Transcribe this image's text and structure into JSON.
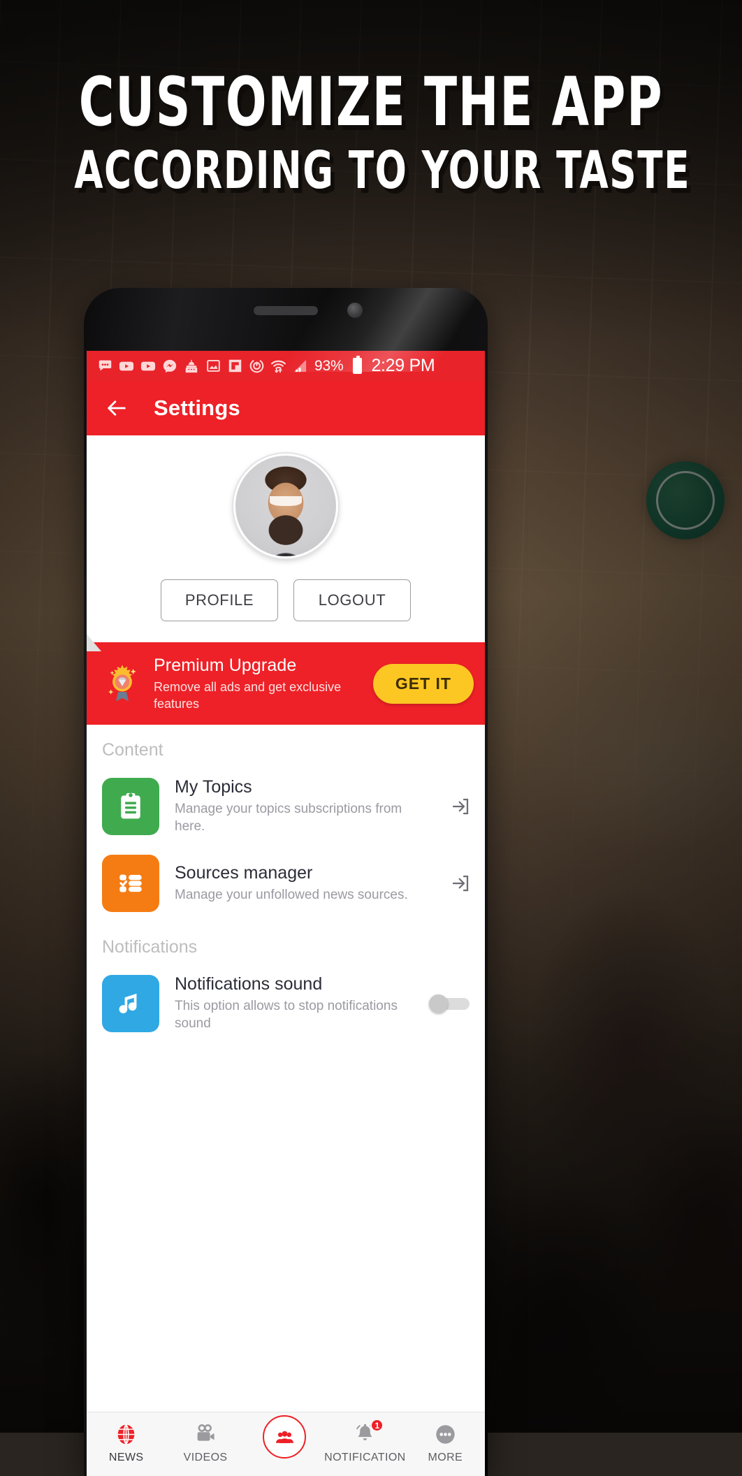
{
  "promo": {
    "headline_line1": "CUSTOMIZE THE APP",
    "headline_line2": "ACCORDING TO YOUR TASTE"
  },
  "status_bar": {
    "icons": [
      "messages-dots-icon",
      "youtube-icon",
      "youtube-icon",
      "messenger-icon",
      "temple-icon",
      "photo-icon",
      "flipboard-icon",
      "power-timer-icon",
      "wifi-transfer-icon",
      "cellular-signal-icon"
    ],
    "battery_percent": "93%",
    "battery_icon": "battery-full-icon",
    "time": "2:29 PM"
  },
  "app_bar": {
    "back_icon": "back-arrow-icon",
    "title": "Settings"
  },
  "profile": {
    "avatar_icon": "user-avatar",
    "buttons": [
      {
        "label": "PROFILE",
        "name": "profile-button"
      },
      {
        "label": "LOGOUT",
        "name": "logout-button"
      }
    ]
  },
  "premium": {
    "badge_icon": "premium-diamond-badge-icon",
    "title": "Premium Upgrade",
    "subtitle": "Remove all ads and get exclusive features",
    "cta_label": "GET IT",
    "cta_color": "#fdc723",
    "background_color": "#ed2127"
  },
  "sections": [
    {
      "header": "Content",
      "rows": [
        {
          "title": "My Topics",
          "subtitle": "Manage your topics subscriptions from here.",
          "icon": "clipboard-icon",
          "icon_color": "#3fab4e",
          "trailing": "open-external-icon"
        },
        {
          "title": "Sources manager",
          "subtitle": "Manage your unfollowed news sources.",
          "icon": "checklist-icon",
          "icon_color": "#f57c13",
          "trailing": "open-external-icon"
        }
      ]
    },
    {
      "header": "Notifications",
      "rows": [
        {
          "title": "Notifications sound",
          "subtitle": "This option allows to stop notifications sound",
          "icon": "music-note-icon",
          "icon_color": "#2fa8e4",
          "trailing": "toggle-switch-off"
        }
      ]
    }
  ],
  "bottom_nav": {
    "items": [
      {
        "label": "NEWS",
        "icon": "globe-icon",
        "active": true
      },
      {
        "label": "VIDEOS",
        "icon": "video-camera-icon",
        "active": false
      },
      {
        "label": "",
        "icon": "people-group-icon",
        "active": false
      },
      {
        "label": "NOTIFICATION",
        "icon": "bell-icon",
        "active": false,
        "badge": "1"
      },
      {
        "label": "MORE",
        "icon": "more-dots-icon",
        "active": false
      }
    ]
  }
}
